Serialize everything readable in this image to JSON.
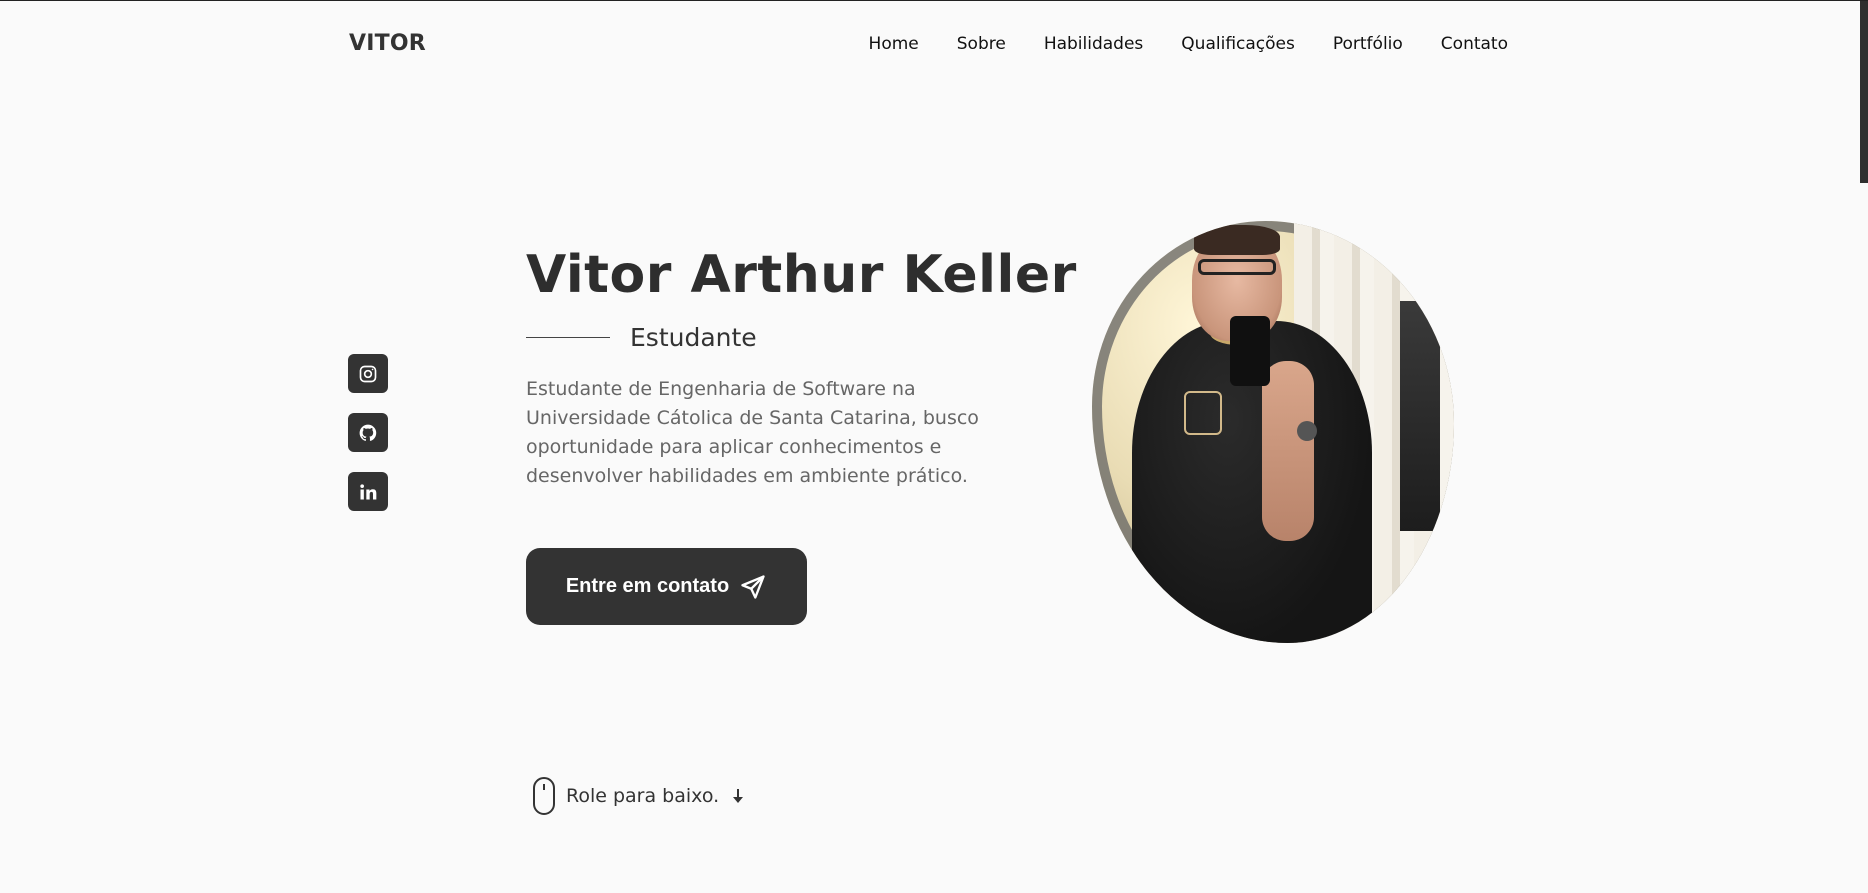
{
  "header": {
    "logo": "VITOR",
    "nav": [
      "Home",
      "Sobre",
      "Habilidades",
      "Qualificações",
      "Portfólio",
      "Contato"
    ]
  },
  "socials": [
    {
      "icon": "instagram-icon"
    },
    {
      "icon": "github-icon"
    },
    {
      "icon": "linkedin-icon"
    }
  ],
  "hero": {
    "name": "Vitor Arthur Keller",
    "role": "Estudante",
    "description": "Estudante de Engenharia de Software na Universidade Cátolica de Santa Catarina, busco oportunidade para aplicar conhecimentos e desenvolver habilidades em ambiente prático.",
    "cta_label": "Entre em contato",
    "cta_icon": "send-icon"
  },
  "scroll_hint": {
    "label": "Role para baixo.",
    "icon": "mouse-icon"
  },
  "colors": {
    "background": "#fafafa",
    "dark": "#333333",
    "text_muted": "#666666"
  }
}
